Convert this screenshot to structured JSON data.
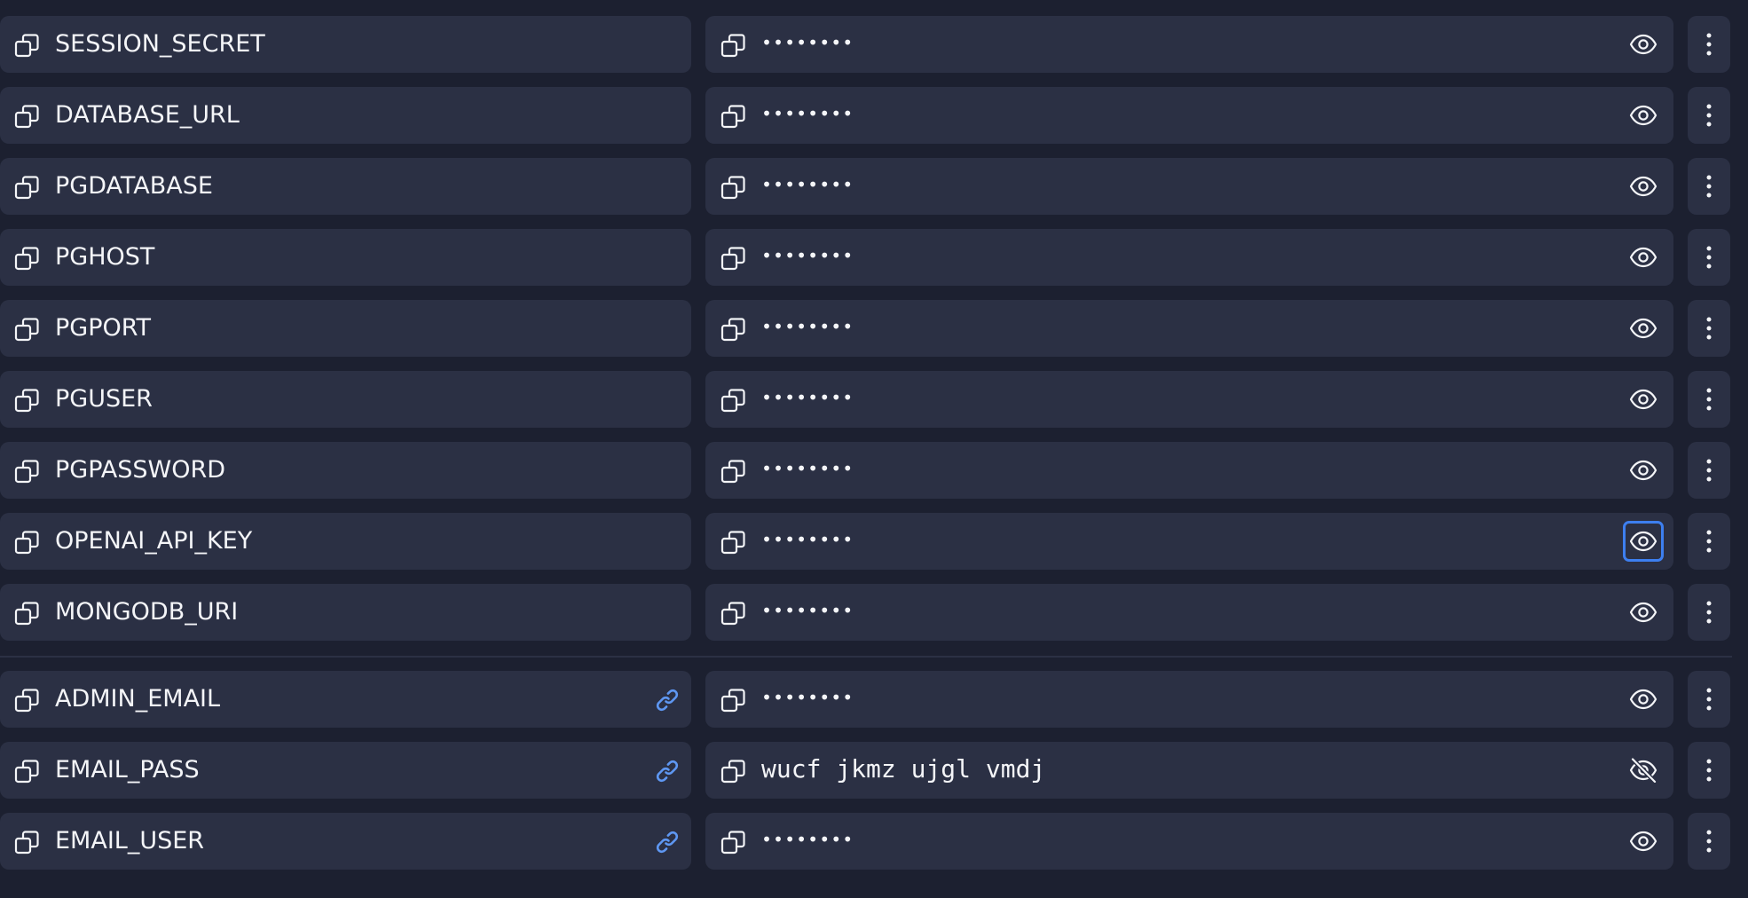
{
  "icons": {
    "copy": "copy-icon",
    "eye": "eye-icon",
    "eye_off": "eye-off-icon",
    "link": "link-icon",
    "menu": "more-vertical-icon"
  },
  "colors": {
    "background": "#1c2030",
    "row": "#2b3044",
    "text": "#f4f5f8",
    "link": "#5e97f2",
    "focus": "#3d7ff0"
  },
  "secrets": [
    {
      "key": "SESSION_SECRET",
      "value": "••••••••",
      "revealed": false,
      "linked": false,
      "focused": false
    },
    {
      "key": "DATABASE_URL",
      "value": "••••••••",
      "revealed": false,
      "linked": false,
      "focused": false
    },
    {
      "key": "PGDATABASE",
      "value": "••••••••",
      "revealed": false,
      "linked": false,
      "focused": false
    },
    {
      "key": "PGHOST",
      "value": "••••••••",
      "revealed": false,
      "linked": false,
      "focused": false
    },
    {
      "key": "PGPORT",
      "value": "••••••••",
      "revealed": false,
      "linked": false,
      "focused": false
    },
    {
      "key": "PGUSER",
      "value": "••••••••",
      "revealed": false,
      "linked": false,
      "focused": false
    },
    {
      "key": "PGPASSWORD",
      "value": "••••••••",
      "revealed": false,
      "linked": false,
      "focused": false
    },
    {
      "key": "OPENAI_API_KEY",
      "value": "••••••••",
      "revealed": false,
      "linked": false,
      "focused": true
    },
    {
      "key": "MONGODB_URI",
      "value": "••••••••",
      "revealed": false,
      "linked": false,
      "focused": false
    },
    {
      "key": "ADMIN_EMAIL",
      "value": "••••••••",
      "revealed": false,
      "linked": true,
      "focused": false
    },
    {
      "key": "EMAIL_PASS",
      "value": "wucf jkmz ujgl vmdj",
      "revealed": true,
      "linked": true,
      "focused": false
    },
    {
      "key": "EMAIL_USER",
      "value": "••••••••",
      "revealed": false,
      "linked": true,
      "focused": false
    }
  ]
}
